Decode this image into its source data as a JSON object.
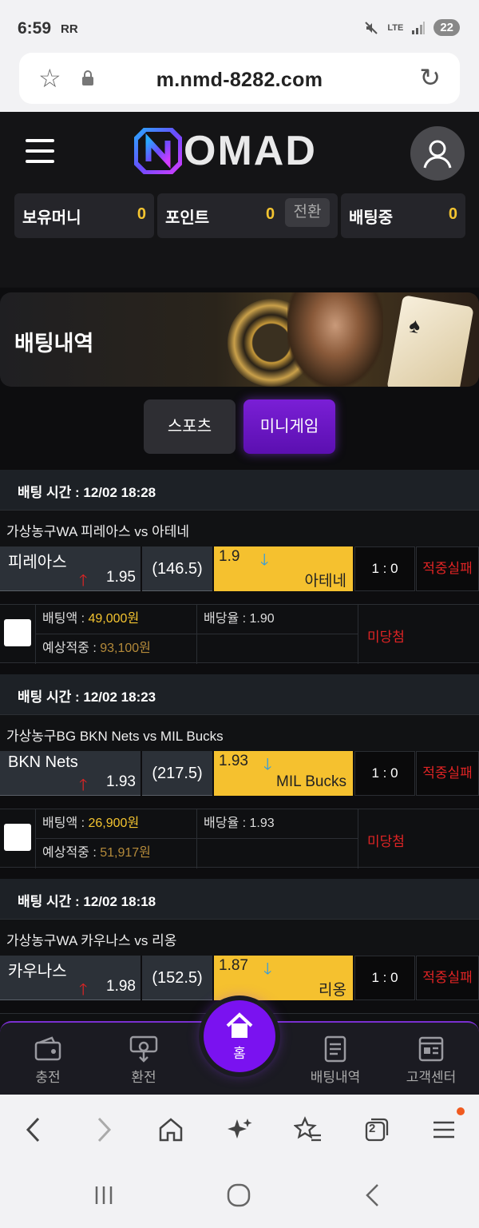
{
  "status": {
    "time": "6:59",
    "carrier": "RR",
    "network": "LTE",
    "battery": "22"
  },
  "browser": {
    "url": "m.nmd-8282.com"
  },
  "header": {
    "logo_text": "OMAD"
  },
  "balances": [
    {
      "label": "보유머니",
      "value": "0"
    },
    {
      "label": "포인트",
      "value": "0",
      "action": "전환"
    },
    {
      "label": "배팅중",
      "value": "0"
    }
  ],
  "banner": {
    "title": "배팅내역"
  },
  "tabs": {
    "sports": "스포츠",
    "minigame": "미니게임"
  },
  "labels": {
    "bet_amount": "배팅액 : ",
    "odds": "배당율 : ",
    "expected": "예상적중 : "
  },
  "bets": [
    {
      "bet_time": "배팅 시간 : 12/02 18:28",
      "game": "가상농구WA 피레아스  vs  아테네",
      "home": {
        "name": "피레아스",
        "odd": "1.95"
      },
      "line": "(146.5)",
      "away": {
        "name": "아테네",
        "odd": "1.9"
      },
      "score": "1 : 0",
      "result": "적중실패",
      "amount": "49,000원",
      "odds": "1.90",
      "expected": "93,100원",
      "status": "미당첨"
    },
    {
      "bet_time": "배팅 시간 : 12/02 18:23",
      "game": "가상농구BG BKN Nets  vs  MIL Bucks",
      "home": {
        "name": "BKN Nets",
        "odd": "1.93"
      },
      "line": "(217.5)",
      "away": {
        "name": "MIL Bucks",
        "odd": "1.93"
      },
      "score": "1 : 0",
      "result": "적중실패",
      "amount": "26,900원",
      "odds": "1.93",
      "expected": "51,917원",
      "status": "미당첨"
    },
    {
      "bet_time": "배팅 시간 : 12/02 18:18",
      "game": "가상농구WA 카우나스  vs  리옹",
      "home": {
        "name": "카우나스",
        "odd": "1.98"
      },
      "line": "(152.5)",
      "away": {
        "name": "리옹",
        "odd": "1.87"
      },
      "score": "1 : 0",
      "result": "적중실패"
    }
  ],
  "bottom_nav": {
    "deposit": "충전",
    "withdraw": "환전",
    "home": "홈",
    "history": "배팅내역",
    "support": "고객센터"
  },
  "browser_nav": {
    "tab_count": "2"
  }
}
